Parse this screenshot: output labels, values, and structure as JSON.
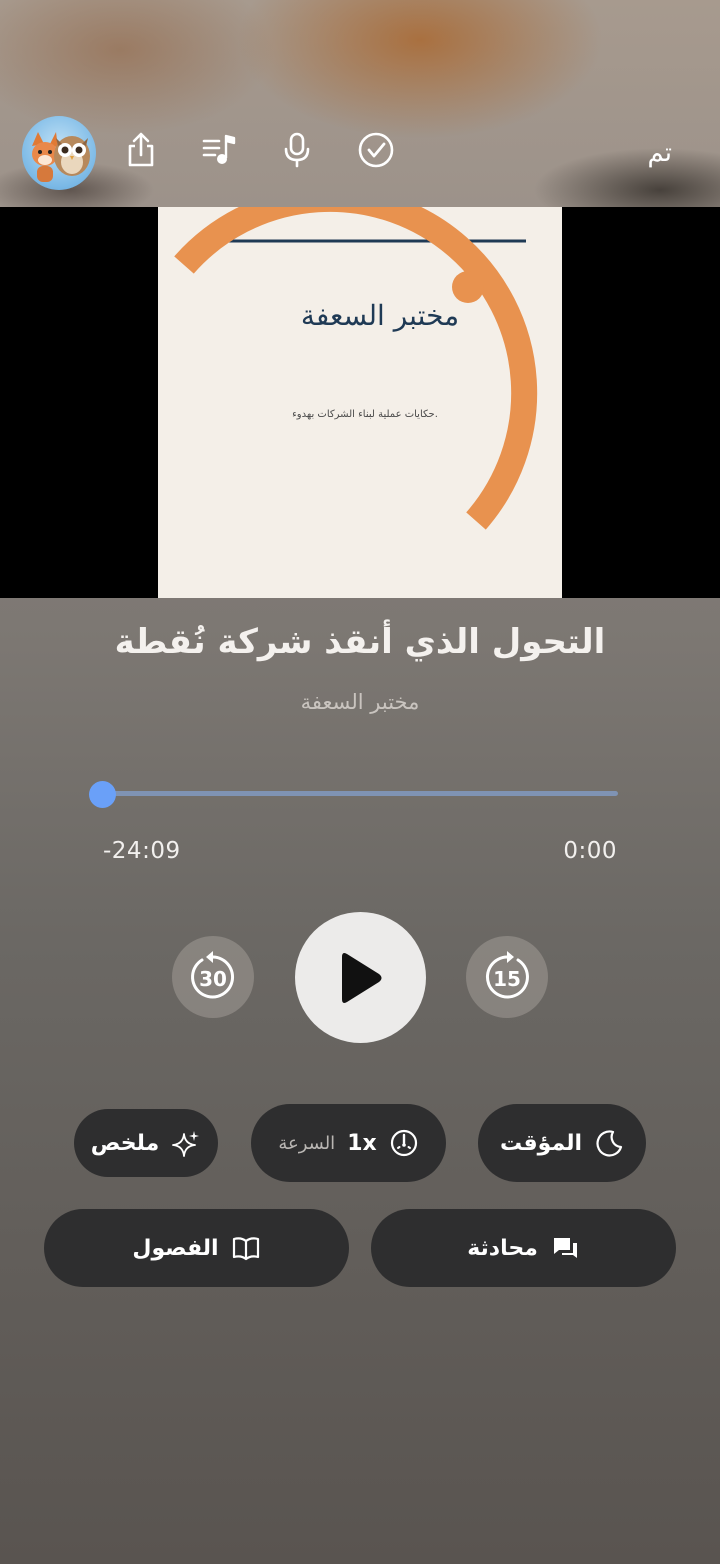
{
  "toolbar": {
    "done_label": "تم",
    "icons": [
      "avatar",
      "share-icon",
      "playlist-icon",
      "microphone-icon",
      "checkmark-icon"
    ]
  },
  "cover": {
    "title": "مختبر السعفة",
    "subtitle": "حكايات عملية لبناء الشركات بهدوء."
  },
  "track": {
    "title": "التحول الذي أنقذ شركة نُقطة",
    "artist": "مختبر السعفة"
  },
  "progress": {
    "elapsed": "0:00",
    "remaining": "-24:09",
    "fraction": 0.0
  },
  "controls": {
    "skip_back_seconds": "30",
    "skip_forward_seconds": "15"
  },
  "actions": {
    "timer_label": "المؤقت",
    "speed_value": "1x",
    "speed_label": "السرعة",
    "summary_label": "ملخص",
    "chat_label": "محادثة",
    "chapters_label": "الفصول"
  },
  "colors": {
    "accent": "#6aa0f8",
    "cover_orange": "#e8924f",
    "cover_navy": "#1f3a55",
    "pill_bg": "#2e2e2f"
  }
}
